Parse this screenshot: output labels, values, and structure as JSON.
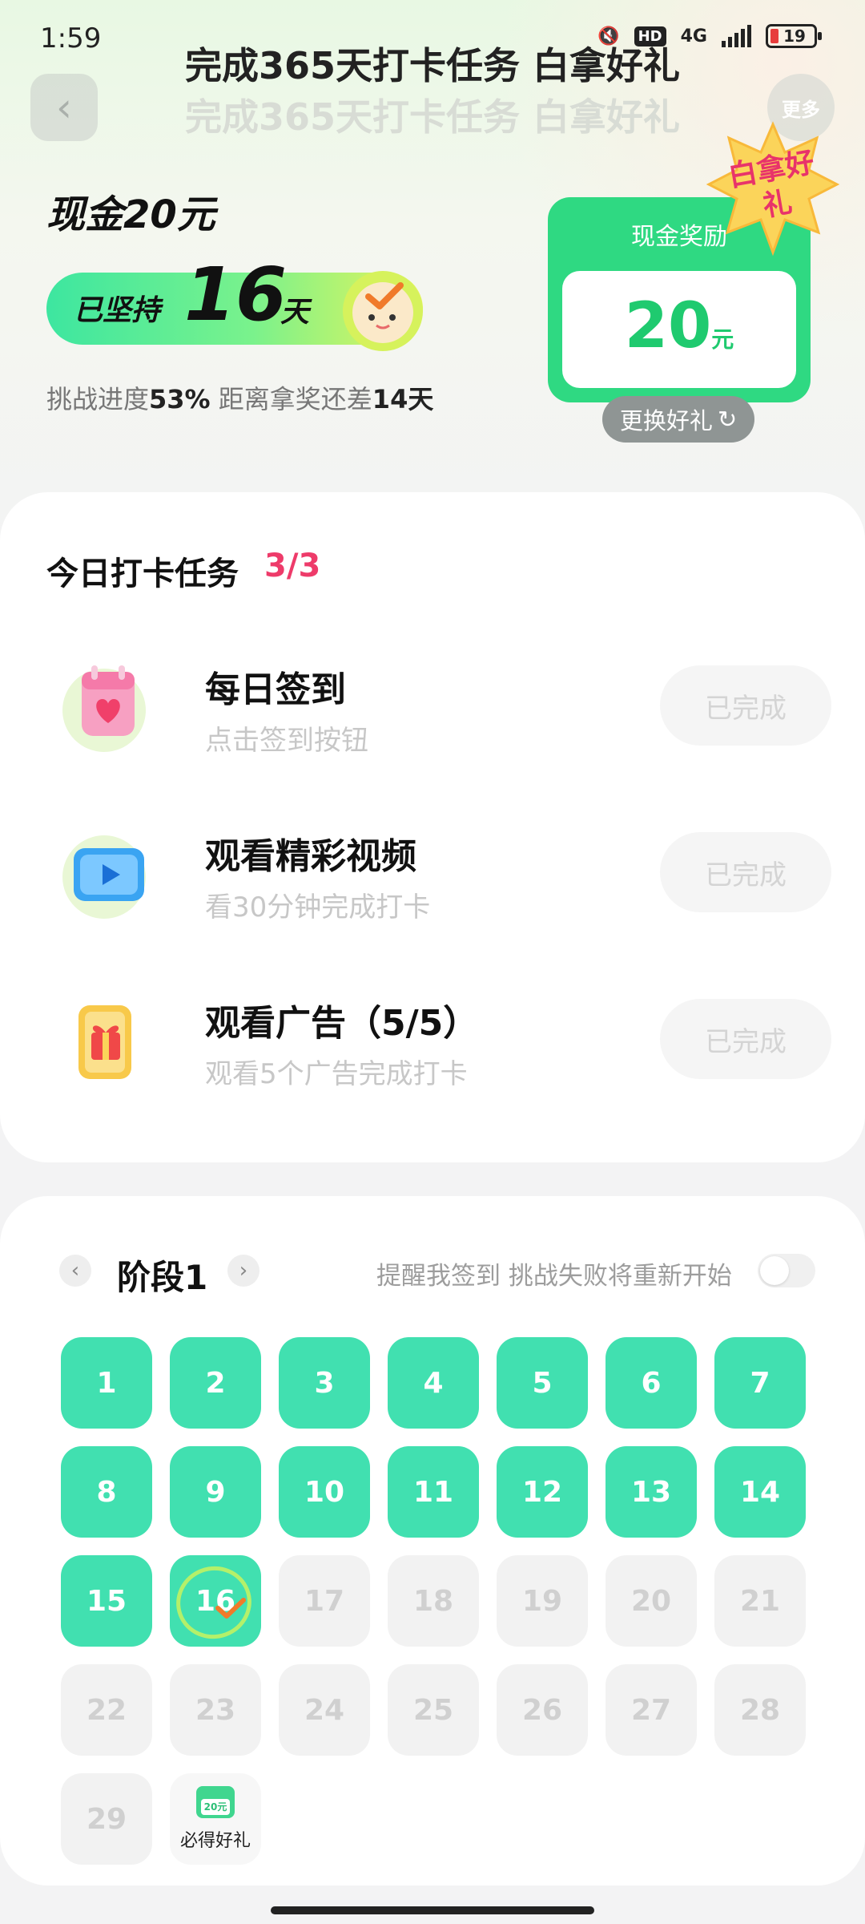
{
  "status_bar": {
    "time": "1:59",
    "network": "4G",
    "hd": "HD",
    "battery": "19",
    "battery_color": "#e73d3d"
  },
  "header": {
    "title": "完成365天打卡任务 白拿好礼",
    "title_ghost": "完成365天打卡任务 白拿好礼",
    "back_icon": "chevron-left-icon",
    "more_label": "更多"
  },
  "hero": {
    "cash_title": "现金20元",
    "streak_prefix": "已坚持",
    "streak_days": "16",
    "streak_unit": "天",
    "progress_prefix": "挑战进度",
    "progress_percent": "53%",
    "progress_mid": " 距离拿奖还差",
    "progress_remaining": "14天",
    "progress_value": 0.53
  },
  "reward": {
    "label": "现金奖励",
    "amount": "20",
    "unit": "元",
    "badge": "白拿好礼",
    "swap_label": "更换好礼",
    "swap_icon": "refresh-icon",
    "accent": "#2fd982"
  },
  "tasks": {
    "title": "今日打卡任务",
    "count": "3/3",
    "count_color": "#ee3b6a",
    "items": [
      {
        "name": "每日签到",
        "desc": "点击签到按钮",
        "button": "已完成",
        "icon": "calendar-heart-icon"
      },
      {
        "name": "观看精彩视频",
        "desc": "看30分钟完成打卡",
        "button": "已完成",
        "icon": "video-play-icon"
      },
      {
        "name": "观看广告（5/5）",
        "desc": "观看5个广告完成打卡",
        "button": "已完成",
        "icon": "gift-box-icon"
      }
    ]
  },
  "calendar": {
    "stage_label": "阶段1",
    "remind_text": "提醒我签到 挑战失败将重新开始",
    "remind_enabled": false,
    "days": [
      "1",
      "2",
      "3",
      "4",
      "5",
      "6",
      "7",
      "8",
      "9",
      "10",
      "11",
      "12",
      "13",
      "14",
      "15",
      "16",
      "17",
      "18",
      "19",
      "20",
      "21",
      "22",
      "23",
      "24",
      "25",
      "26",
      "27",
      "28",
      "29"
    ],
    "completed_through": 16,
    "today": 16,
    "prize_label": "必得好礼",
    "prize_icon_text": "20元",
    "done_color": "#41e0b0"
  }
}
